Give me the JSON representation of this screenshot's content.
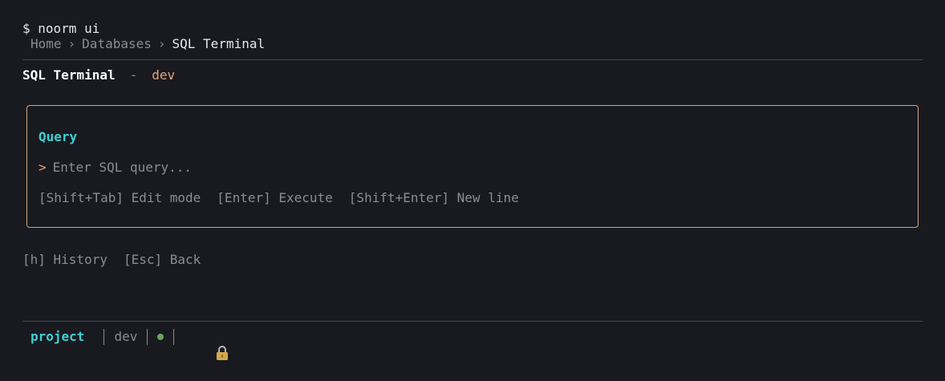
{
  "terminal": {
    "prompt": "$ noorm ui"
  },
  "breadcrumb": {
    "items": [
      "Home",
      "Databases",
      "SQL Terminal"
    ],
    "separator": "›"
  },
  "header": {
    "title": "SQL Terminal",
    "dash": "-",
    "env": "dev"
  },
  "query_panel": {
    "title": "Query",
    "caret": ">",
    "input_value": "",
    "placeholder": "Enter SQL query...",
    "hints": [
      "[Shift+Tab] Edit mode",
      "[Enter] Execute",
      "[Shift+Enter] New line"
    ]
  },
  "footer_hints": [
    "[h] History",
    "[Esc] Back"
  ],
  "status_bar": {
    "project": "project",
    "env": "dev",
    "connection_icon": "green-dot-icon",
    "lock_icon": "lock-icon"
  },
  "colors": {
    "background": "#181a20",
    "accent_cyan": "#3fd0d4",
    "accent_orange": "#e8a574",
    "panel_border": "#d7a67a",
    "status_green": "#6fa35a"
  }
}
